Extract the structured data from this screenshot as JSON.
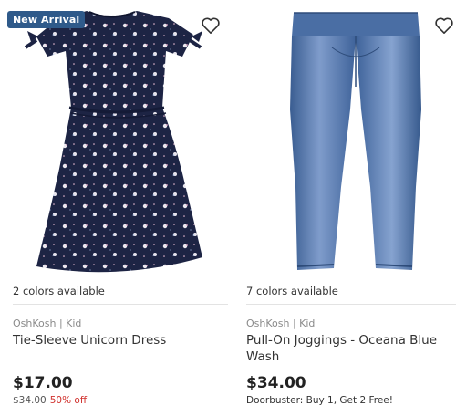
{
  "products": [
    {
      "badge": "New Arrival",
      "colors_available": "2 colors available",
      "brand": "OshKosh | Kid",
      "name": "Tie-Sleeve Unicorn Dress",
      "price": "$17.00",
      "was_price": "$34.00",
      "discount": "50% off",
      "favorite_icon": "heart-icon",
      "image": "navy unicorn print dress"
    },
    {
      "colors_available": "7 colors available",
      "brand": "OshKosh | Kid",
      "name": "Pull-On Joggings - Oceana Blue Wash",
      "price": "$34.00",
      "promo": "Doorbuster: Buy 1, Get 2 Free!",
      "favorite_icon": "heart-icon",
      "image": "blue denim jeggings"
    }
  ],
  "colors": {
    "badge_bg": "#2f5a8a",
    "discount": "#d0312d",
    "dress_navy": "#1d2444",
    "denim": "#4e73a8"
  }
}
